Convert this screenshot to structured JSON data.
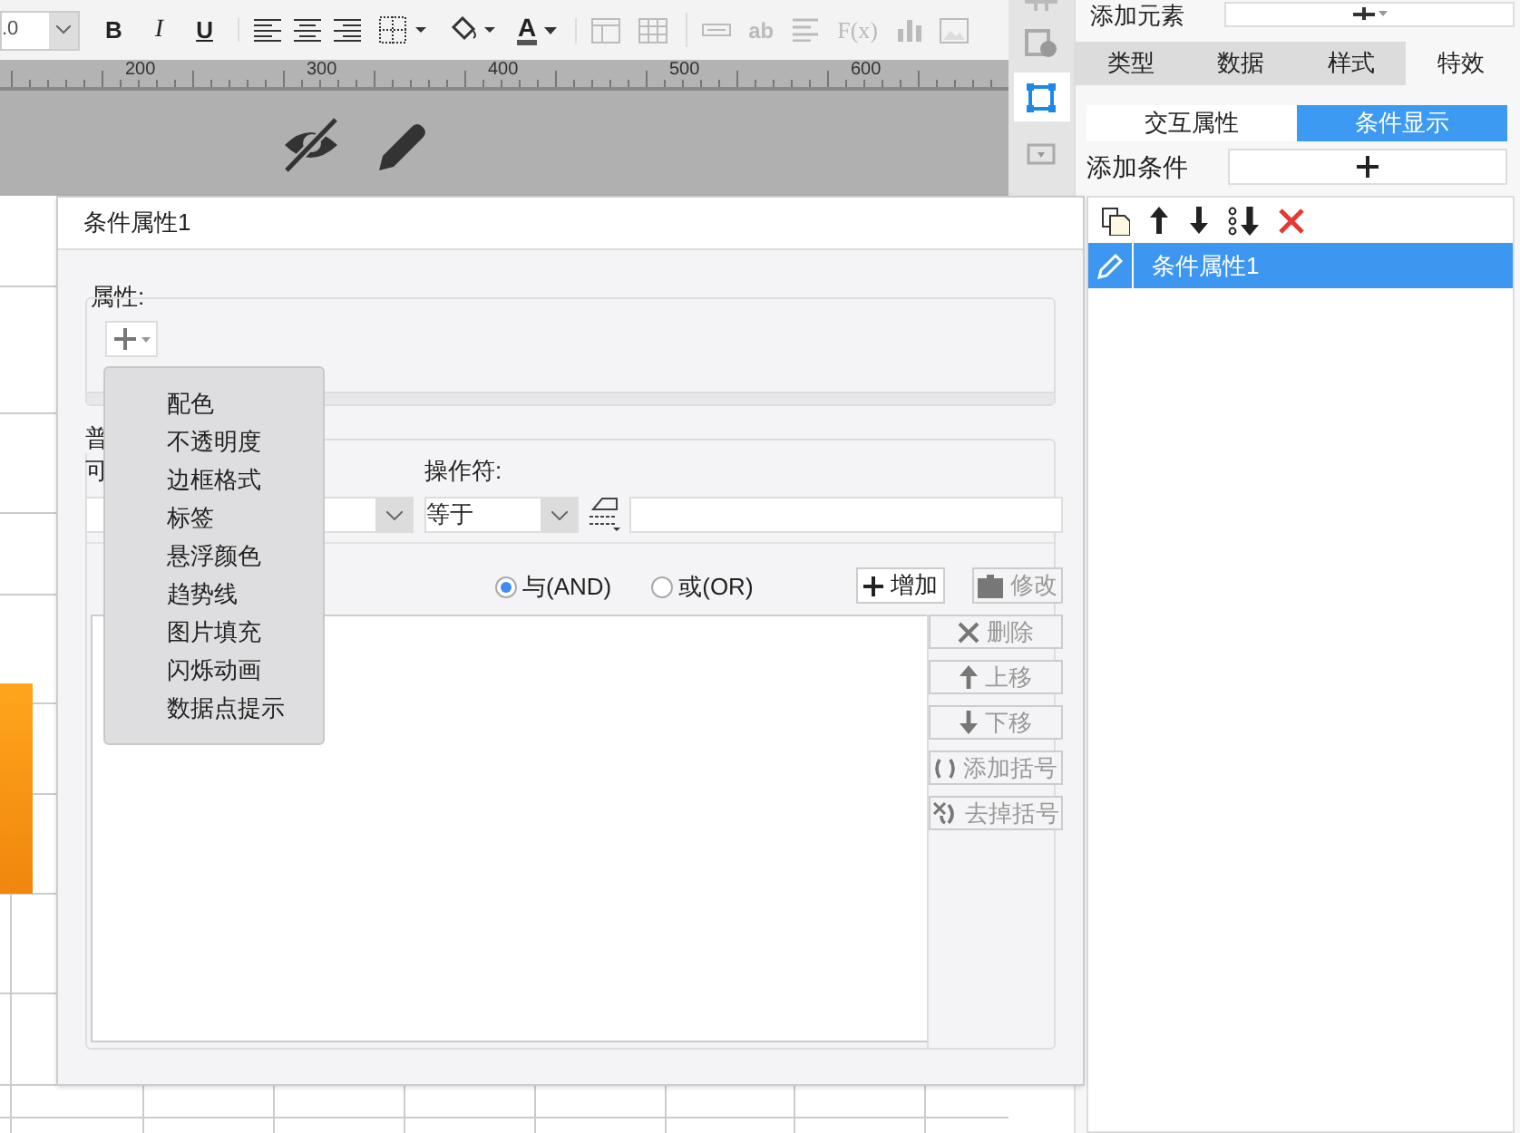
{
  "toolbar": {
    "font_size": ".0",
    "bold": "B",
    "italic": "I",
    "underline": "U",
    "font_color": "A",
    "text_tool": "ab",
    "formula": "F(x)"
  },
  "ruler": {
    "labels": [
      "200",
      "300",
      "400",
      "500",
      "600"
    ]
  },
  "right_panel": {
    "add_element_label": "添加元素",
    "tabs": [
      {
        "label": "类型",
        "selected": false
      },
      {
        "label": "数据",
        "selected": false
      },
      {
        "label": "样式",
        "selected": false
      },
      {
        "label": "特效",
        "selected": true
      }
    ],
    "sub_tabs": [
      {
        "label": "交互属性",
        "selected": false
      },
      {
        "label": "条件显示",
        "selected": true
      }
    ],
    "add_condition_label": "添加条件",
    "conditions": [
      {
        "label": "条件属性1",
        "selected": true
      }
    ]
  },
  "dialog": {
    "title": "条件属性1",
    "property_label": "属性:",
    "menu": [
      "配色",
      "不透明度",
      "边框格式",
      "标签",
      "悬浮颜色",
      "趋势线",
      "图片填充",
      "闪烁动画",
      "数据点提示"
    ],
    "group_label": "普",
    "variable_label": "可",
    "operator_label": "操作符:",
    "operator_value": "等于",
    "logic": [
      {
        "label": "与(AND)",
        "selected": true
      },
      {
        "label": "或(OR)",
        "selected": false
      }
    ],
    "add_button": {
      "label": "增加",
      "disabled": false
    },
    "edit_button": {
      "label": "修改",
      "disabled": true
    },
    "side_buttons": [
      {
        "label": "删除",
        "kind": "delete",
        "disabled": true
      },
      {
        "label": "上移",
        "kind": "up",
        "disabled": true
      },
      {
        "label": "下移",
        "kind": "down",
        "disabled": true
      },
      {
        "label": "添加括号",
        "kind": "add-bracket",
        "disabled": true
      },
      {
        "label": "去掉括号",
        "kind": "remove-bracket",
        "disabled": true
      }
    ]
  }
}
